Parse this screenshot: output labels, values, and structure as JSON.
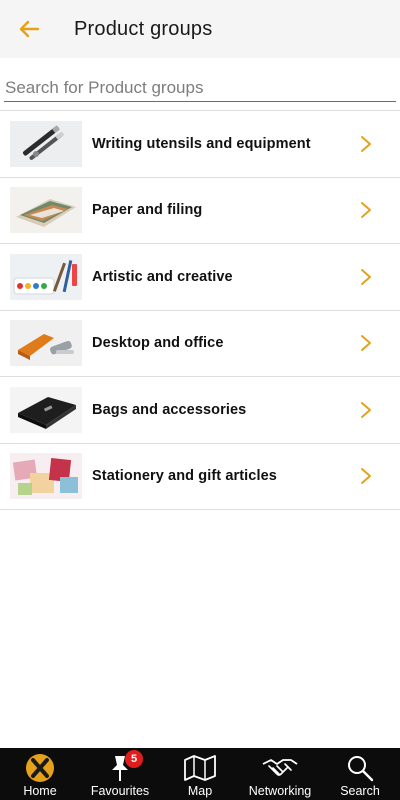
{
  "header": {
    "title": "Product groups",
    "back_icon": "arrow-left-icon",
    "accent": "#e6a11a"
  },
  "search": {
    "placeholder": "Search for Product groups",
    "value": ""
  },
  "groups": [
    {
      "label": "Writing utensils and equipment",
      "thumb": "pens-image"
    },
    {
      "label": "Paper and filing",
      "thumb": "paper-image"
    },
    {
      "label": "Artistic and creative",
      "thumb": "paints-image"
    },
    {
      "label": "Desktop and office",
      "thumb": "stapler-image"
    },
    {
      "label": "Bags and accessories",
      "thumb": "bag-image"
    },
    {
      "label": "Stationery and gift articles",
      "thumb": "gifts-image"
    }
  ],
  "tabbar": {
    "tabs": [
      {
        "label": "Home",
        "icon": "home-logo-icon"
      },
      {
        "label": "Favourites",
        "icon": "pin-icon",
        "badge": "5"
      },
      {
        "label": "Map",
        "icon": "map-icon"
      },
      {
        "label": "Networking",
        "icon": "handshake-icon"
      },
      {
        "label": "Search",
        "icon": "search-icon"
      }
    ]
  },
  "colors": {
    "tabbar_bg": "#0c0c0c",
    "badge": "#e21b1b",
    "chevron": "#e6a11a"
  }
}
